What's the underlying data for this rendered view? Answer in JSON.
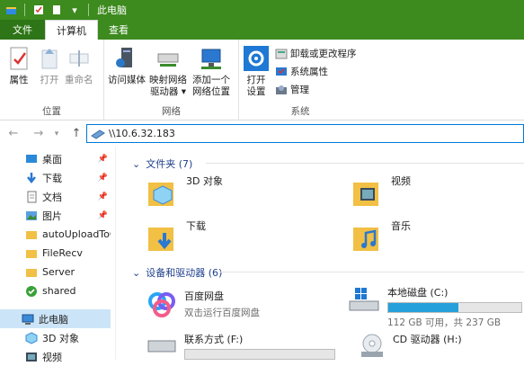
{
  "window": {
    "title": "此电脑"
  },
  "tabs": {
    "file": "文件",
    "computer": "计算机",
    "view": "查看"
  },
  "ribbon": {
    "location": {
      "label": "位置",
      "properties": "属性",
      "open": "打开",
      "rename": "重命名"
    },
    "network": {
      "label": "网络",
      "access_media": "访问媒体",
      "map_drive": "映射网络",
      "map_drive2": "驱动器",
      "add_location": "添加一个",
      "add_location2": "网络位置"
    },
    "system": {
      "label": "系统",
      "open_settings": "打开",
      "open_settings2": "设置",
      "uninstall": "卸载或更改程序",
      "sys_props": "系统属性",
      "manage": "管理"
    }
  },
  "address": {
    "path": "\\\\10.6.32.183"
  },
  "sidebar": {
    "items": [
      {
        "label": "桌面"
      },
      {
        "label": "下载"
      },
      {
        "label": "文档"
      },
      {
        "label": "图片"
      },
      {
        "label": "autoUploadToC"
      },
      {
        "label": "FileRecv"
      },
      {
        "label": "Server"
      },
      {
        "label": "shared"
      },
      {
        "label": "此电脑"
      },
      {
        "label": "3D 对象"
      },
      {
        "label": "视频"
      }
    ]
  },
  "folders": {
    "header": "文件夹 (7)",
    "items": [
      {
        "label": "3D 对象"
      },
      {
        "label": "视频"
      },
      {
        "label": "下载"
      },
      {
        "label": "音乐"
      }
    ]
  },
  "devices": {
    "header": "设备和驱动器 (6)",
    "baidu": {
      "name": "百度网盘",
      "desc": "双击运行百度网盘"
    },
    "local_c": {
      "name": "本地磁盘 (C:)",
      "usage": "112 GB 可用，共 237 GB",
      "used_fraction": 0.53
    },
    "contact_f": {
      "name": "联系方式 (F:)",
      "used_fraction": 0
    },
    "cd_h": {
      "name": "CD 驱动器 (H:)"
    }
  },
  "colors": {
    "accent": "#3d8a1e",
    "select": "#cce4f7",
    "bar": "#26a0da"
  }
}
